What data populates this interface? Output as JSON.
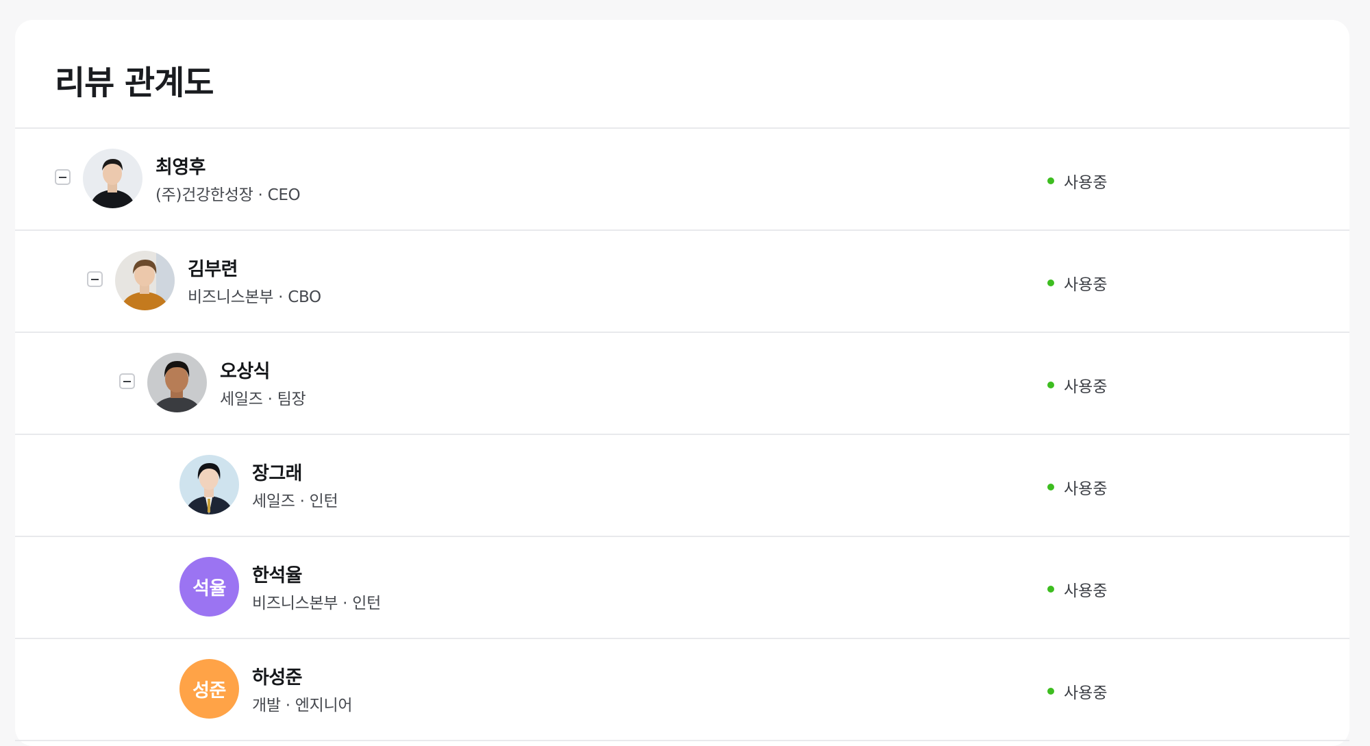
{
  "title": "리뷰 관계도",
  "status_color": "#3dbd20",
  "people": [
    {
      "name": "최영후",
      "org": "(주)건강한성장",
      "role": "CEO",
      "status": "사용중",
      "avatar": "photo",
      "expandable": true
    },
    {
      "name": "김부련",
      "org": "비즈니스본부",
      "role": "CBO",
      "status": "사용중",
      "avatar": "photo",
      "expandable": true
    },
    {
      "name": "오상식",
      "org": "세일즈",
      "role": "팀장",
      "status": "사용중",
      "avatar": "photo",
      "expandable": true
    },
    {
      "name": "장그래",
      "org": "세일즈",
      "role": "인턴",
      "status": "사용중",
      "avatar": "photo",
      "expandable": false
    },
    {
      "name": "한석율",
      "org": "비즈니스본부",
      "role": "인턴",
      "status": "사용중",
      "avatar": "initials",
      "initials": "석율",
      "avatar_color": "#9b74f2",
      "expandable": false
    },
    {
      "name": "하성준",
      "org": "개발",
      "role": "엔지니어",
      "status": "사용중",
      "avatar": "initials",
      "initials": "성준",
      "avatar_color": "#ffa347",
      "expandable": false
    }
  ]
}
